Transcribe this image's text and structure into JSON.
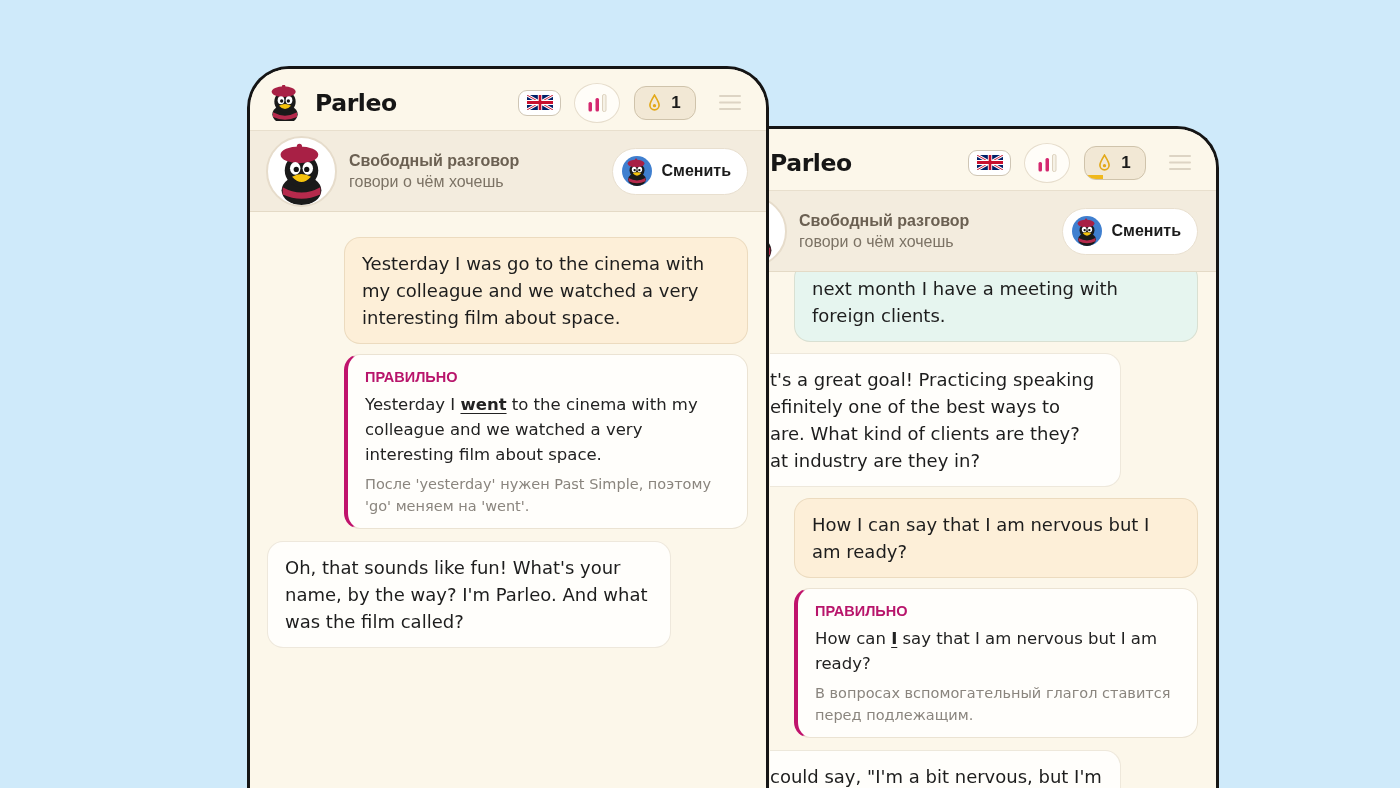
{
  "phones": [
    {
      "header": {
        "logo_icon": true,
        "brand": "Parleo",
        "counter": {
          "value": "1"
        }
      },
      "mode": {
        "avatar_cut": false,
        "title": "Свободный разговор",
        "subtitle": "говори о чём хочешь",
        "button": "Сменить"
      },
      "messages": [
        {
          "kind": "user",
          "color": "#fdefd8",
          "text": "Yesterday I was go to the cinema with my colleague and we watched a very interesting film about space."
        },
        {
          "kind": "correction",
          "label": "ПРАВИЛЬНО",
          "text": "Yesterday I **went** to the cinema with my colleague and we watched a very interesting film about space.",
          "note": "После 'yesterday' нужен Past Simple, поэтому 'go' меняем на 'went'."
        },
        {
          "kind": "bot",
          "text": "Oh, that sounds like fun! What's your name, by the way? I'm Parleo. And what was the film called?"
        }
      ]
    },
    {
      "header": {
        "logo_icon": false,
        "brand": "Parleo",
        "counter": {
          "value": "1",
          "level": 0.3
        }
      },
      "mode": {
        "avatar_cut": true,
        "title": "Свободный разговор",
        "subtitle": "говори о чём хочешь",
        "button": "Сменить"
      },
      "messages": [
        {
          "kind": "user",
          "color": "#e6f5ef",
          "cut_top": true,
          "text": "next month I have a meeting with foreign clients."
        },
        {
          "kind": "bot",
          "cut_left": true,
          "lines": [
            "t's a great goal! Practicing speaking",
            "efinitely one of the best ways to",
            "are. What kind of clients are they?",
            "at industry are they in?"
          ]
        },
        {
          "kind": "user",
          "color": "#fdefd8",
          "text": "How I can say that I am nervous but I am ready?"
        },
        {
          "kind": "correction",
          "label": "ПРАВИЛЬНО",
          "text": "How can **I** say that I am nervous but I am ready?",
          "note": "В вопросах вспомогательный глагол ставится перед подлежащим."
        },
        {
          "kind": "bot",
          "cut_left": true,
          "lines": [
            "could say, \"I'm a bit nervous, but I'm"
          ]
        }
      ]
    }
  ]
}
